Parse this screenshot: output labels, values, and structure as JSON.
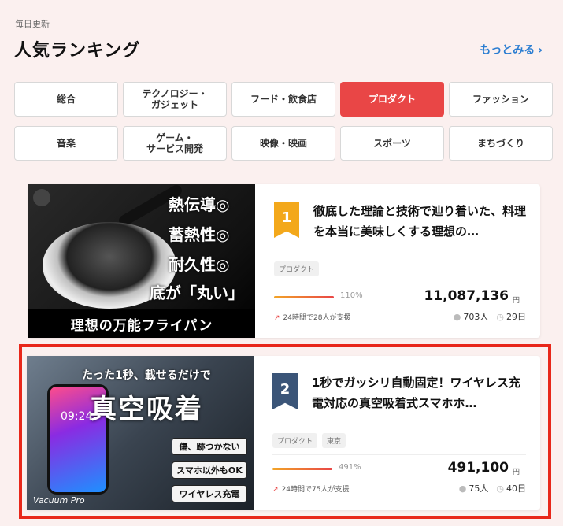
{
  "header": {
    "kicker": "毎日更新",
    "title": "人気ランキング",
    "more_label": "もっとみる",
    "more_chevron": "›"
  },
  "categories": [
    {
      "label": "総合",
      "active": false
    },
    {
      "label": "テクノロジー・\nガジェット",
      "active": false
    },
    {
      "label": "フード・飲食店",
      "active": false
    },
    {
      "label": "プロダクト",
      "active": true
    },
    {
      "label": "ファッション",
      "active": false
    },
    {
      "label": "音楽",
      "active": false
    },
    {
      "label": "ゲーム・\nサービス開発",
      "active": false
    },
    {
      "label": "映像・映画",
      "active": false
    },
    {
      "label": "スポーツ",
      "active": false
    },
    {
      "label": "まちづくり",
      "active": false
    }
  ],
  "colors": {
    "accent": "#e94646",
    "link": "#2a7dd1",
    "rank1": "#f3a81b",
    "rank2": "#3b5578",
    "highlight": "#e8271a"
  },
  "projects": [
    {
      "rank": "1",
      "title": "徹底した理論と技術で辿り着いた、料理を本当に美味しくする理想の…",
      "tags": [
        "プロダクト"
      ],
      "percent_label": "110%",
      "amount": "11,087,136",
      "currency": "円",
      "support": "24時間で28人が支援",
      "supporters": "703人",
      "days": "29日",
      "image_text": {
        "lines": [
          "熱伝導◎",
          "蓄熱性◎",
          "耐久性◎",
          "底が「丸い」"
        ],
        "banner": "理想の万能フライパン"
      }
    },
    {
      "rank": "2",
      "title": "1秒でガッシリ自動固定！ワイヤレス充電対応の真空吸着式スマホホ…",
      "tags": [
        "プロダクト",
        "東京"
      ],
      "percent_label": "491%",
      "amount": "491,100",
      "currency": "円",
      "support": "24時間で75人が支援",
      "supporters": "75人",
      "days": "40日",
      "image_text": {
        "copy": "たった1秒、載せるだけで",
        "headline": "真空吸着",
        "pills": [
          "傷、跡つかない",
          "スマホ以外もOK",
          "ワイヤレス充電"
        ],
        "phone_time": "09:24",
        "brand": "Vacuum Pro"
      }
    }
  ]
}
